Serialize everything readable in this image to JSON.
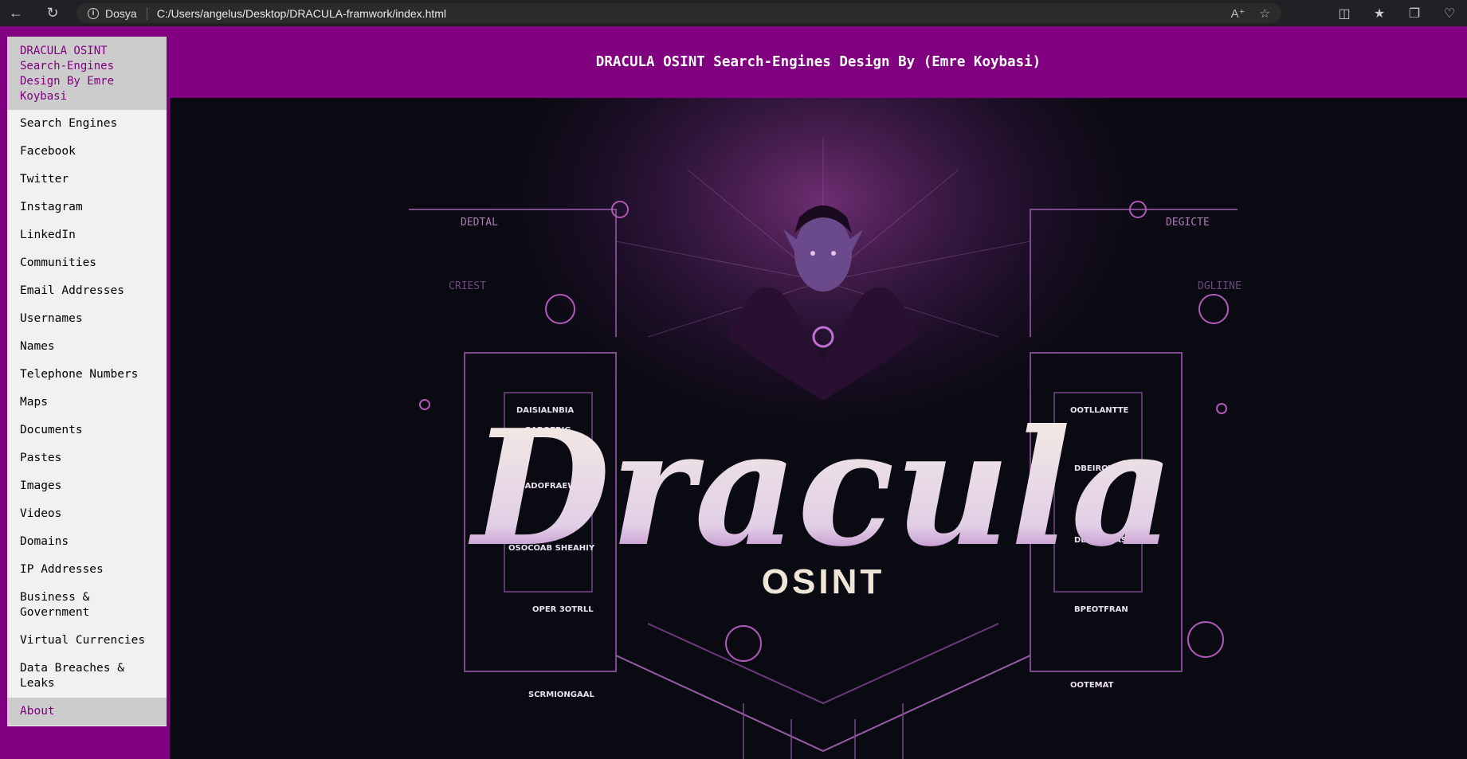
{
  "browser": {
    "site_label": "Dosya",
    "url": "C:/Users/angelus/Desktop/DRACULA-framwork/index.html",
    "icons": [
      "back-arrow-icon",
      "refresh-icon",
      "info-icon",
      "read-aloud-icon",
      "star-icon",
      "split-screen-icon",
      "favorites-icon",
      "collections-icon",
      "health-icon"
    ]
  },
  "header": {
    "title": "DRACULA OSINT Search-Engines Design By (Emre Koybasi)"
  },
  "sidebar": {
    "brand": "DRACULA OSINT Search-Engines Design By Emre Koybasi",
    "items": [
      {
        "label": "Search Engines"
      },
      {
        "label": "Facebook"
      },
      {
        "label": "Twitter"
      },
      {
        "label": "Instagram"
      },
      {
        "label": "LinkedIn"
      },
      {
        "label": "Communities"
      },
      {
        "label": "Email Addresses"
      },
      {
        "label": "Usernames"
      },
      {
        "label": "Names"
      },
      {
        "label": "Telephone Numbers"
      },
      {
        "label": "Maps"
      },
      {
        "label": "Documents"
      },
      {
        "label": "Pastes"
      },
      {
        "label": "Images"
      },
      {
        "label": "Videos"
      },
      {
        "label": "Domains"
      },
      {
        "label": "IP Addresses"
      },
      {
        "label": "Business & Government"
      },
      {
        "label": "Virtual Currencies"
      },
      {
        "label": "Data Breaches & Leaks"
      },
      {
        "label": "About"
      }
    ]
  },
  "hero": {
    "logo_text": "Dracula",
    "logo_subtext": "OSINT",
    "colors": {
      "background": "#0a0a12",
      "accent": "#800080",
      "glow": "#c04ac0",
      "logo": "#efe6d8"
    }
  }
}
